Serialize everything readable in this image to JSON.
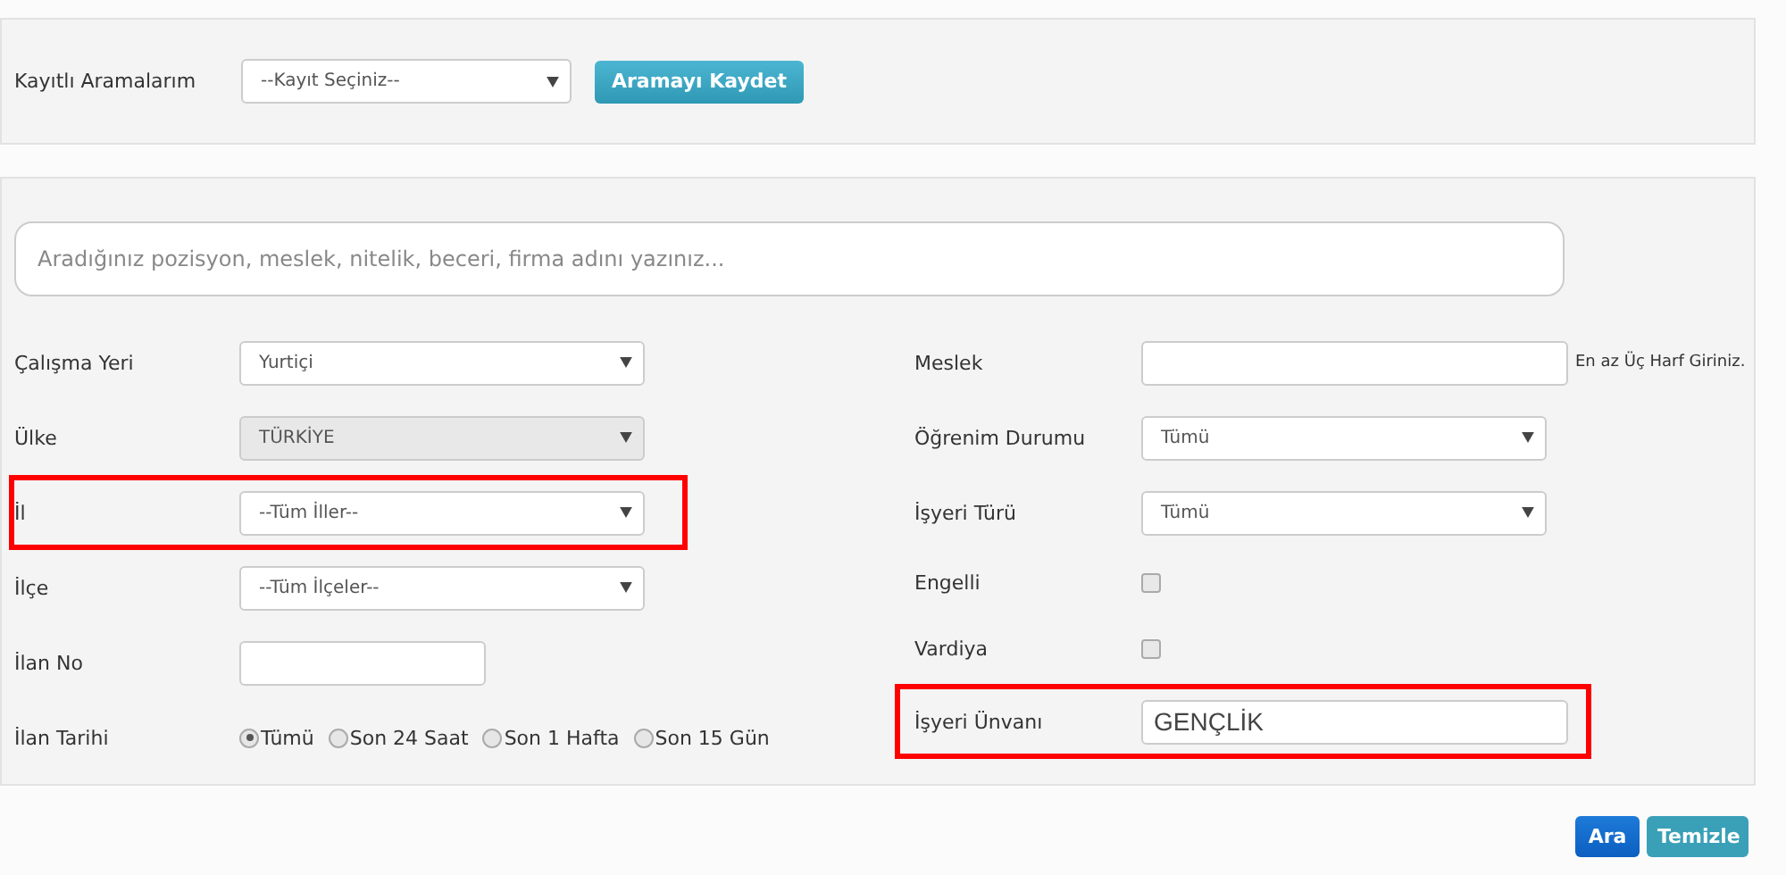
{
  "saved_searches": {
    "label": "Kayıtlı Aramalarım",
    "select": "--Kayıt Seçiniz--",
    "button": "Aramayı Kaydet"
  },
  "search": {
    "placeholder": "Aradığınız pozisyon, meslek, nitelik, beceri, firma adını yazınız..."
  },
  "left_fields": [
    {
      "kind": "select",
      "label": "Çalışma Yeri",
      "value": "Yurtiçi",
      "disabled": false,
      "highlighted": false
    },
    {
      "kind": "select",
      "label": "Ülke",
      "value": "TÜRKİYE",
      "disabled": true,
      "highlighted": false
    },
    {
      "kind": "select",
      "label": "İl",
      "value": "--Tüm İller--",
      "disabled": false,
      "highlighted": true
    },
    {
      "kind": "select",
      "label": "İlçe",
      "value": "--Tüm İlçeler--",
      "disabled": false,
      "highlighted": false
    },
    {
      "kind": "input",
      "label": "İlan No",
      "highlighted": false
    },
    {
      "kind": "radios",
      "label": "İlan Tarihi",
      "highlighted": false,
      "options": [
        {
          "label": "Tümü",
          "selected": true
        },
        {
          "label": "Son 24 Saat",
          "selected": false
        },
        {
          "label": "Son 1 Hafta",
          "selected": false
        },
        {
          "label": "Son 15 Gün",
          "selected": false
        }
      ]
    }
  ],
  "right_fields": [
    {
      "kind": "input",
      "label": "Meslek",
      "hint": "En az Üç Harf Giriniz.",
      "highlighted": false
    },
    {
      "kind": "select",
      "label": "Öğrenim Durumu",
      "value": "Tümü",
      "disabled": false,
      "highlighted": false
    },
    {
      "kind": "select",
      "label": "İşyeri Türü",
      "value": "Tümü",
      "disabled": false,
      "highlighted": false
    },
    {
      "kind": "checkbox",
      "label": "Engelli",
      "checked": false,
      "highlighted": false
    },
    {
      "kind": "checkbox",
      "label": "Vardiya",
      "checked": false,
      "highlighted": false
    },
    {
      "kind": "input",
      "label": "İşyeri Ünvanı",
      "value": "GENÇLİK",
      "highlighted": true
    }
  ],
  "buttons": [
    {
      "label": "Ara",
      "kind": "primary"
    },
    {
      "label": "Temizle",
      "kind": "secondary"
    }
  ]
}
